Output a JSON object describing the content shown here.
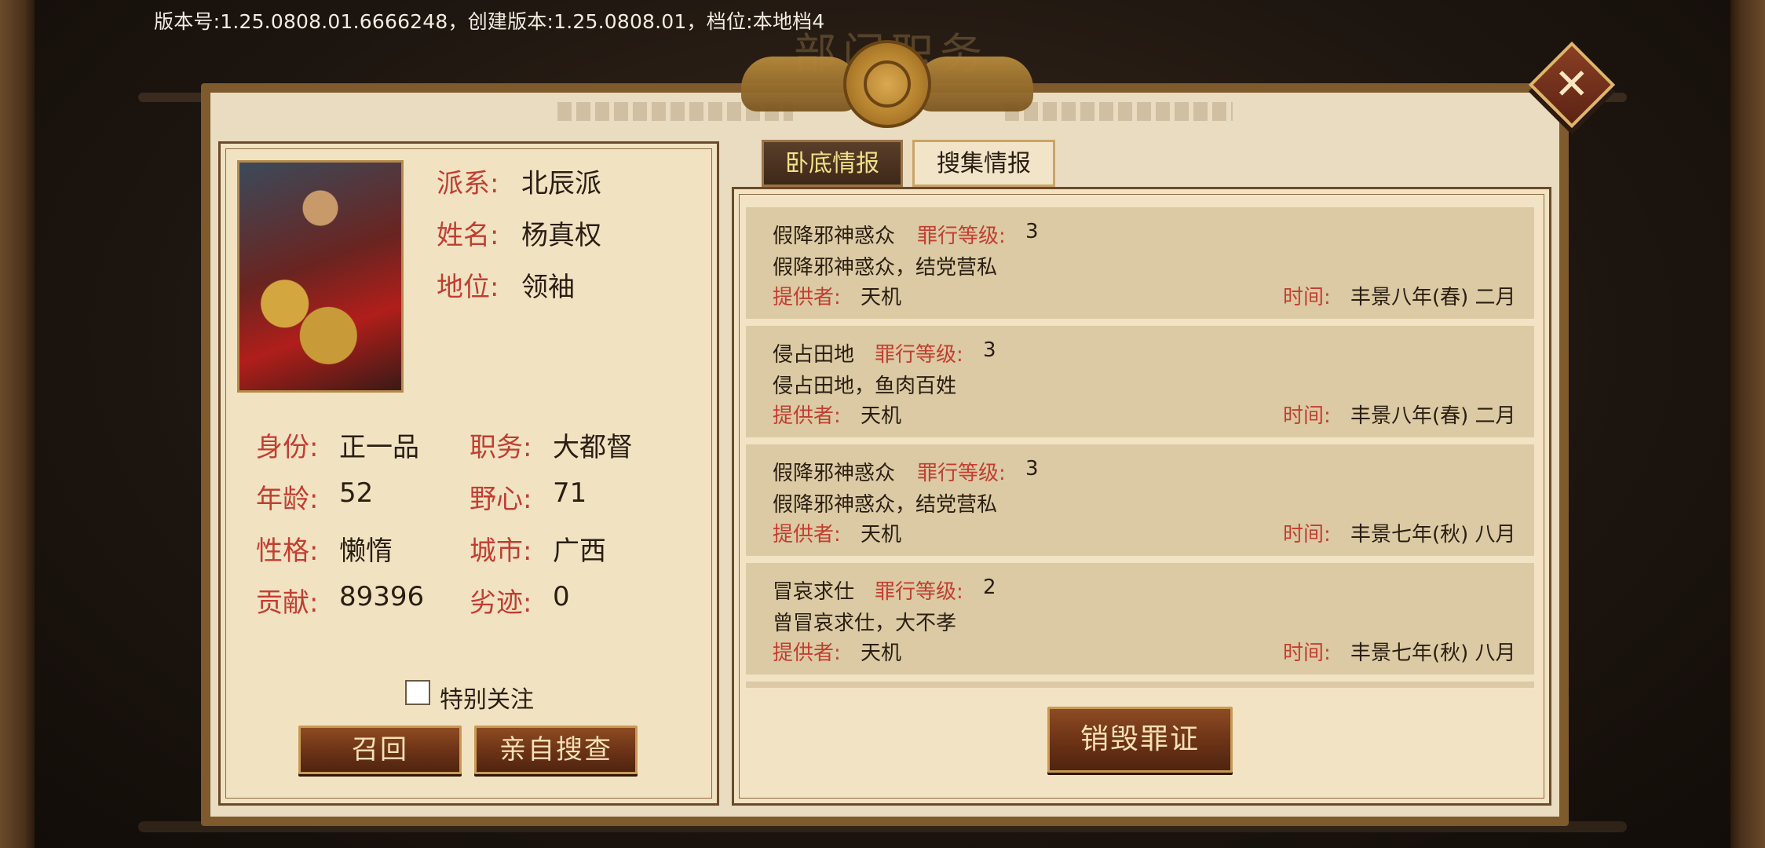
{
  "version_bar": "版本号:1.25.0808.01.6666248，创建版本:1.25.0808.01，档位:本地档4",
  "window_title": "部门职务",
  "close_glyph": "✕",
  "profile": {
    "faction_label": "派系:",
    "faction": "北辰派",
    "name_label": "姓名:",
    "name": "杨真权",
    "status_label": "地位:",
    "status": "领袖",
    "rank_label": "身份:",
    "rank": "正一品",
    "post_label": "职务:",
    "post": "大都督",
    "age_label": "年龄:",
    "age": "52",
    "ambition_label": "野心:",
    "ambition": "71",
    "personality_label": "性格:",
    "personality": "懒惰",
    "city_label": "城市:",
    "city": "广西",
    "contribution_label": "贡献:",
    "contribution": "89396",
    "misdeeds_label": "劣迹:",
    "misdeeds": "0"
  },
  "special_watch": {
    "label": "特别关注",
    "checked": false
  },
  "buttons": {
    "recall": "召回",
    "investigate": "亲自搜查",
    "destroy": "销毁罪证"
  },
  "tabs": [
    {
      "label": "卧底情报",
      "active": true
    },
    {
      "label": "搜集情报",
      "active": false
    }
  ],
  "intel_labels": {
    "crime_level": "罪行等级:",
    "provider": "提供者:",
    "time": "时间:"
  },
  "intel": [
    {
      "title": "假降邪神惑众",
      "level": "3",
      "desc": "假降邪神惑众，结党营私",
      "provider": "天机",
      "time": "丰景八年(春) 二月"
    },
    {
      "title": "侵占田地",
      "level": "3",
      "desc": "侵占田地，鱼肉百姓",
      "provider": "天机",
      "time": "丰景八年(春) 二月"
    },
    {
      "title": "假降邪神惑众",
      "level": "3",
      "desc": "假降邪神惑众，结党营私",
      "provider": "天机",
      "time": "丰景七年(秋) 八月"
    },
    {
      "title": "冒哀求仕",
      "level": "2",
      "desc": "曾冒哀求仕，大不孝",
      "provider": "天机",
      "time": "丰景七年(秋) 八月"
    }
  ],
  "colors": {
    "label_red": "#c23e32",
    "tab_active_text": "#f0e08a",
    "panel_parchment": "#f1e3c4",
    "entry_bg": "#dbcaa3",
    "frame_brown": "#6b4a2a"
  }
}
